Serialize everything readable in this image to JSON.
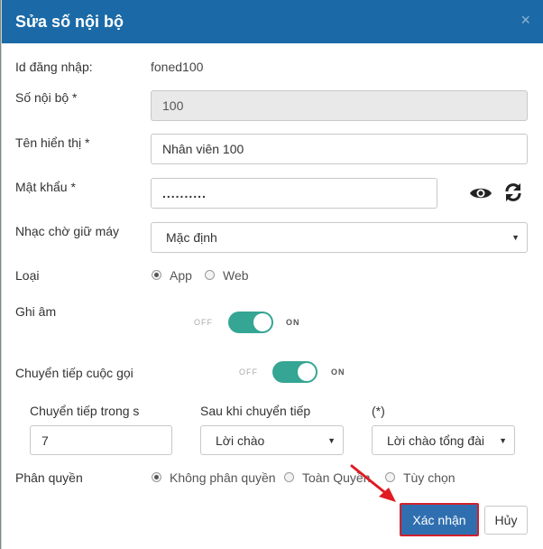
{
  "dialog": {
    "title": "Sửa số nội bộ",
    "close_label": "×"
  },
  "form": {
    "login_id_label": "Id đăng nhập:",
    "login_id_value": "foned100",
    "extension_label": "Số nội bộ *",
    "extension_value": "100",
    "display_name_label": "Tên hiển thị *",
    "display_name_value": "Nhân viên 100",
    "password_label": "Mật khẩu *",
    "password_value": "..........",
    "hold_music_label": "Nhạc chờ giữ máy",
    "hold_music_value": "Mặc định",
    "type_label": "Loại",
    "type_options": [
      "App",
      "Web"
    ],
    "type_selected": "App",
    "record_label": "Ghi âm",
    "record_off": "OFF",
    "record_on": "ON",
    "record_enabled": true,
    "forward_label": "Chuyển tiếp cuộc gọi",
    "forward_off": "OFF",
    "forward_on": "ON",
    "forward_enabled": true,
    "forward_within_label": "Chuyển tiếp trong s",
    "forward_within_value": "7",
    "after_forward_label": "Sau khi chuyển tiếp",
    "after_forward_value": "Lời chào",
    "star_label": "(*)",
    "star_value": "Lời chào tổng đài",
    "permission_label": "Phân quyền",
    "permission_options": [
      "Không phân quyền",
      "Toàn Quyền",
      "Tùy chọn"
    ],
    "permission_selected": "Không phân quyền"
  },
  "footer": {
    "confirm_label": "Xác nhận",
    "cancel_label": "Hủy"
  },
  "colors": {
    "header": "#1b6aa7",
    "toggle_on": "#35a594",
    "primary_button": "#2f6fb0",
    "highlight": "#d0212c"
  }
}
